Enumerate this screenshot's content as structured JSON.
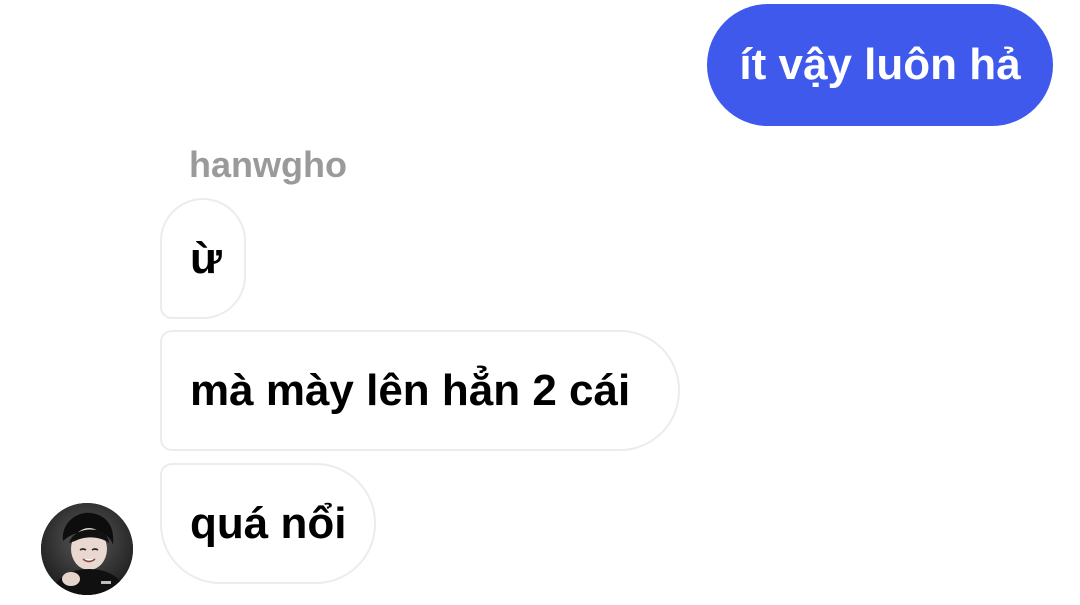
{
  "conversation": {
    "sent": [
      {
        "text": "ít vậy luôn hả"
      }
    ],
    "received_group": {
      "sender": "hanwgho",
      "messages": [
        {
          "text": "ừ"
        },
        {
          "text": "mà mày lên hẳn 2 cái"
        },
        {
          "text": "quá nổi"
        }
      ],
      "avatar_icon": "user-avatar-photo"
    }
  },
  "colors": {
    "sent_bubble": "#3e59ec",
    "sent_text": "#ffffff",
    "received_border": "#ececec",
    "received_text": "#000000",
    "sender_name": "#9a9a9a",
    "background": "#ffffff"
  }
}
